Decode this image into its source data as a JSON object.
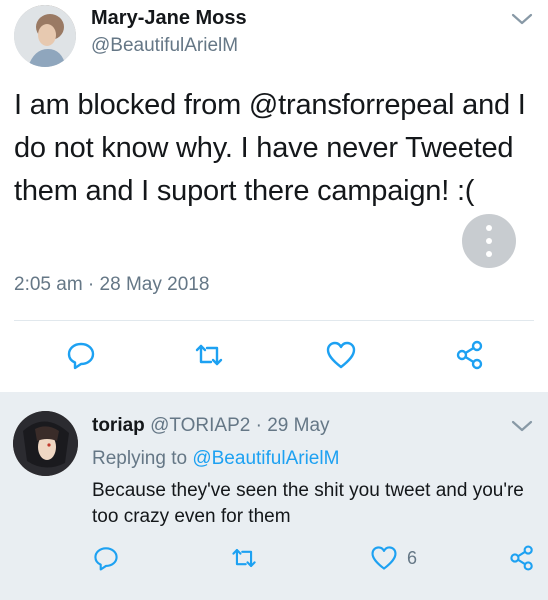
{
  "tweet": {
    "author_name": "Mary-Jane Moss",
    "author_handle": "@BeautifulArielM",
    "text": "I am blocked from @transforrepeal and I do not know why. I have never Tweeted them and I suport there campaign! :(",
    "timestamp": "2:05 am · 28 May 2018",
    "actions": [
      "reply-icon",
      "retweet-icon",
      "like-icon",
      "share-icon"
    ]
  },
  "reply": {
    "author_name": "toriap",
    "author_handle": "@TORIAP2",
    "separator": " · ",
    "date": "29 May",
    "replying_prefix": "Replying to ",
    "replying_to": "@BeautifulArielM",
    "text": "Because they've seen the shit you tweet and you're too crazy even for them",
    "like_count": "6"
  },
  "colors": {
    "text": "#14171a",
    "secondary": "#657786",
    "link": "#1da1f2",
    "icon": "#1da1f2",
    "reply_bg": "#e9eef2",
    "divider": "#e1e8ed"
  }
}
